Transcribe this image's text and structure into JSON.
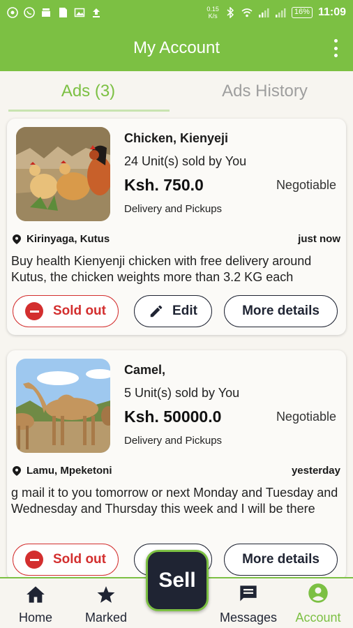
{
  "status_bar": {
    "speed_value": "0.15",
    "speed_unit": "K/s",
    "battery": "16%",
    "time": "11:09"
  },
  "app_bar": {
    "title": "My Account"
  },
  "tabs": [
    {
      "label": "Ads (3)",
      "active": true
    },
    {
      "label": "Ads History",
      "active": false
    }
  ],
  "ads": [
    {
      "title": "Chicken, Kienyeji",
      "units": "24 Unit(s) sold by You",
      "price": "Ksh. 750.0",
      "negotiable": "Negotiable",
      "delivery": "Delivery and Pickups",
      "location": "Kirinyaga, Kutus",
      "posted": "just now",
      "description": "Buy health Kienyenji chicken with free delivery around Kutus, the chicken weights more than 3.2 KG each",
      "sold_out_label": "Sold out",
      "edit_label": "Edit",
      "more_label": "More details"
    },
    {
      "title": "Camel,",
      "units": "5 Unit(s) sold by You",
      "price": "Ksh. 50000.0",
      "negotiable": "Negotiable",
      "delivery": "Delivery and Pickups",
      "location": "Lamu, Mpeketoni",
      "posted": "yesterday",
      "description": "g mail it to you tomorrow or next Monday and Tuesday and Wednesday and Thursday this week and I will be there",
      "sold_out_label": "Sold out",
      "more_label": "More details"
    }
  ],
  "bottom_nav": {
    "home": "Home",
    "marked": "Marked",
    "sell": "Sell",
    "messages": "Messages",
    "account": "Account"
  },
  "colors": {
    "brand_green": "#7cc043",
    "navy": "#1f2433",
    "sold_out_red": "#d32f2f"
  }
}
